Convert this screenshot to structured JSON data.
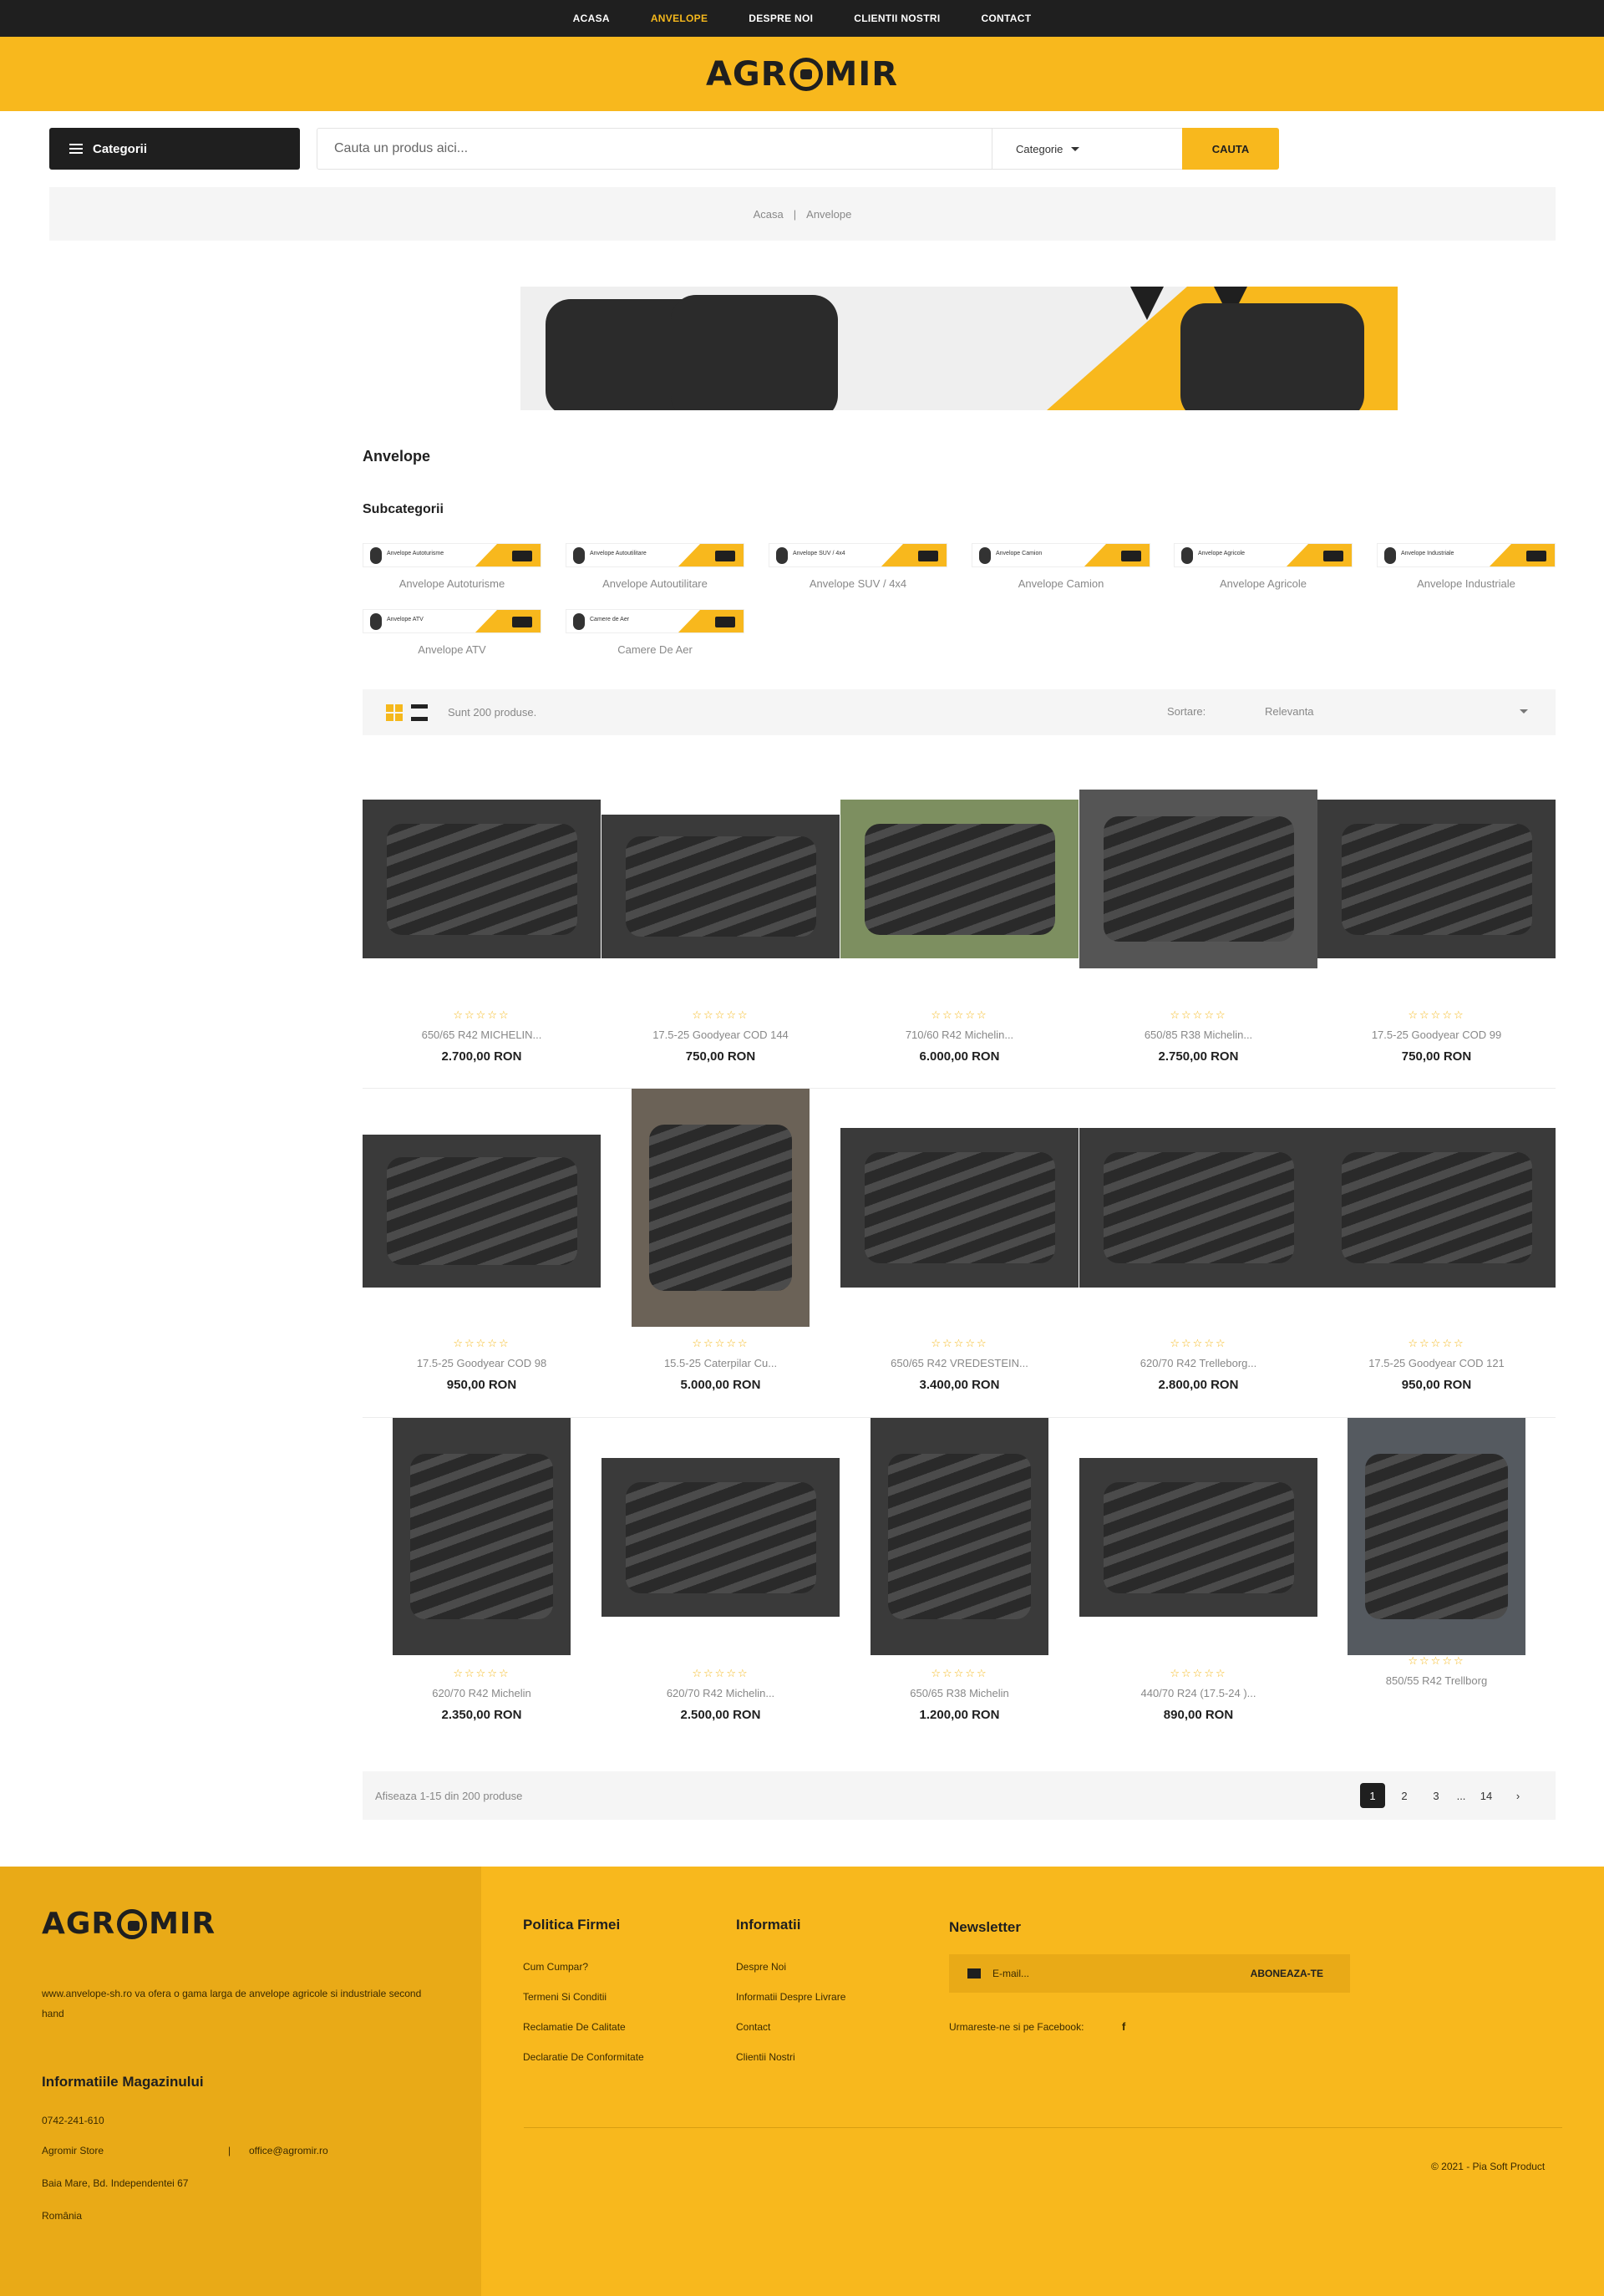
{
  "topnav": [
    "ACASA",
    "ANVELOPE",
    "DESPRE NOI",
    "CLIENTII NOSTRI",
    "CONTACT"
  ],
  "brand": {
    "left": "AGR",
    "right": "MIR"
  },
  "search": {
    "categories_label": "Categorii",
    "placeholder": "Cauta un produs aici...",
    "category_select": "Categorie",
    "button": "CAUTA"
  },
  "breadcrumb": {
    "home": "Acasa",
    "sep": "|",
    "current": "Anvelope"
  },
  "page_title": "Anvelope",
  "subcategories_title": "Subcategorii",
  "subcategories": [
    {
      "name": "Anvelope Autoturisme",
      "tag": "Anvelope Autoturisme"
    },
    {
      "name": "Anvelope Autoutilitare",
      "tag": "Anvelope Autoutilitare"
    },
    {
      "name": "Anvelope SUV / 4x4",
      "tag": "Anvelope SUV / 4x4"
    },
    {
      "name": "Anvelope Camion",
      "tag": "Anvelope Camion"
    },
    {
      "name": "Anvelope Agricole",
      "tag": "Anvelope Agricole"
    },
    {
      "name": "Anvelope Industriale",
      "tag": "Anvelope Industriale"
    },
    {
      "name": "Anvelope ATV",
      "tag": "Anvelope ATV"
    },
    {
      "name": "Camere De Aer",
      "tag": "Camere de Aer"
    }
  ],
  "toolbar": {
    "count": "Sunt 200 produse.",
    "sort_label": "Sortare:",
    "sort_value": "Relevanta"
  },
  "stars": "☆☆☆☆☆",
  "products": [
    {
      "name": "650/65 R42 MICHELIN...",
      "price": "2.700,00 RON"
    },
    {
      "name": "17.5-25 Goodyear COD 144",
      "price": "750,00 RON"
    },
    {
      "name": "710/60 R42 Michelin...",
      "price": "6.000,00 RON"
    },
    {
      "name": "650/85 R38 Michelin...",
      "price": "2.750,00 RON"
    },
    {
      "name": "17.5-25 Goodyear COD 99",
      "price": "750,00 RON"
    },
    {
      "name": "17.5-25 Goodyear COD 98",
      "price": "950,00 RON"
    },
    {
      "name": "15.5-25 Caterpilar Cu...",
      "price": "5.000,00 RON"
    },
    {
      "name": "650/65 R42 VREDESTEIN...",
      "price": "3.400,00 RON"
    },
    {
      "name": "620/70 R42 Trelleborg...",
      "price": "2.800,00 RON"
    },
    {
      "name": "17.5-25 Goodyear COD 121",
      "price": "950,00 RON"
    },
    {
      "name": "620/70 R42 Michelin",
      "price": "2.350,00 RON"
    },
    {
      "name": "620/70 R42 Michelin...",
      "price": "2.500,00 RON"
    },
    {
      "name": "650/65 R38 Michelin",
      "price": "1.200,00 RON"
    },
    {
      "name": "440/70 R24 (17.5-24 )...",
      "price": "890,00 RON"
    },
    {
      "name": "850/55 R42 Trellborg",
      "price": ""
    }
  ],
  "pagination": {
    "info": "Afiseaza 1-15 din 200 produse",
    "pages": [
      "1",
      "2",
      "3",
      "...",
      "14",
      "›"
    ]
  },
  "footer": {
    "about": "www.anvelope-sh.ro va ofera o gama larga de anvelope agricole si industriale second hand",
    "store_title": "Informatiile Magazinului",
    "phone": "0742-241-610",
    "store": "Agromir Store",
    "divider": "|",
    "email": "office@agromir.ro",
    "address": "Baia Mare, Bd. Independentei 67",
    "country": "România",
    "policy_title": "Politica Firmei",
    "policy_links": [
      "Cum Cumpar?",
      "Termeni Si Conditii",
      "Reclamatie De Calitate",
      "Declaratie De Conformitate"
    ],
    "info_title": "Informatii",
    "info_links": [
      "Despre Noi",
      "Informatii Despre Livrare",
      "Contact",
      "Clientii Nostri"
    ],
    "newsletter_title": "Newsletter",
    "newsletter_placeholder": "E-mail...",
    "newsletter_button": "ABONEAZA-TE",
    "facebook_label": "Urmareste-ne si pe Facebook:",
    "facebook_icon": "f",
    "copyright": "© 2021 - Pia Soft Product"
  },
  "colors": {
    "accent": "#f8b81d",
    "dark": "#1f1f1f",
    "footer_dark": "#e9aa17"
  }
}
